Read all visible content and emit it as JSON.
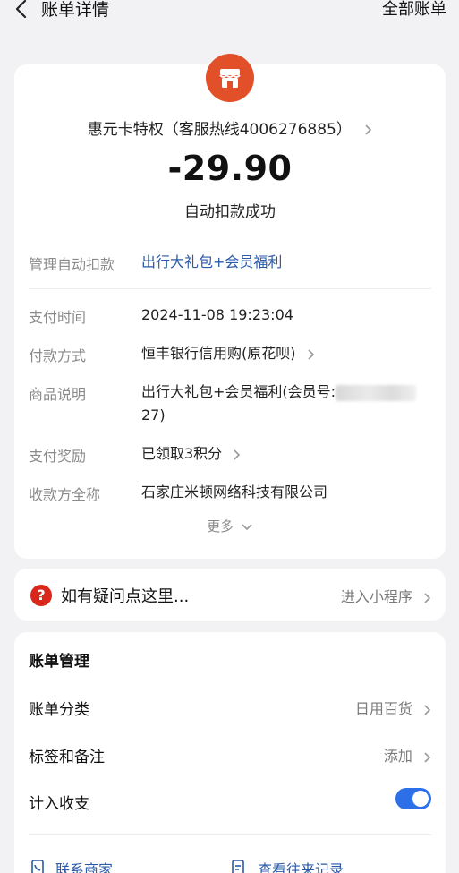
{
  "header": {
    "title": "账单详情",
    "right_link": "全部账单"
  },
  "bill": {
    "merchant_name": "惠元卡特权（客服热线4006276885）",
    "amount": "-29.90",
    "status": "自动扣款成功"
  },
  "details": {
    "auto_debit_label": "管理自动扣款",
    "auto_debit_value": "出行大礼包+会员福利",
    "pay_time_label": "支付时间",
    "pay_time_value": "2024-11-08 19:23:04",
    "pay_method_label": "付款方式",
    "pay_method_value": "恒丰银行信用购(原花呗)",
    "product_label": "商品说明",
    "product_value_prefix": "出行大礼包+会员福利(会员号:",
    "product_value_suffix": "27)",
    "reward_label": "支付奖励",
    "reward_value": "已领取3积分",
    "payee_label": "收款方全称",
    "payee_value": "石家庄米顿网络科技有限公司",
    "more_label": "更多"
  },
  "help": {
    "icon_glyph": "?",
    "text": "如有疑问点这里...",
    "action": "进入小程序"
  },
  "manage": {
    "title": "账单管理",
    "category_label": "账单分类",
    "category_value": "日用百货",
    "tag_label": "标签和备注",
    "tag_value": "添加",
    "count_label": "计入收支",
    "count_enabled": true,
    "contact_label": "联系商家",
    "history_label": "查看往来记录"
  },
  "colors": {
    "accent": "#2d6fe8",
    "link": "#2a5aa8",
    "merchant_logo": "#e2502a",
    "help_icon": "#d9281b"
  }
}
